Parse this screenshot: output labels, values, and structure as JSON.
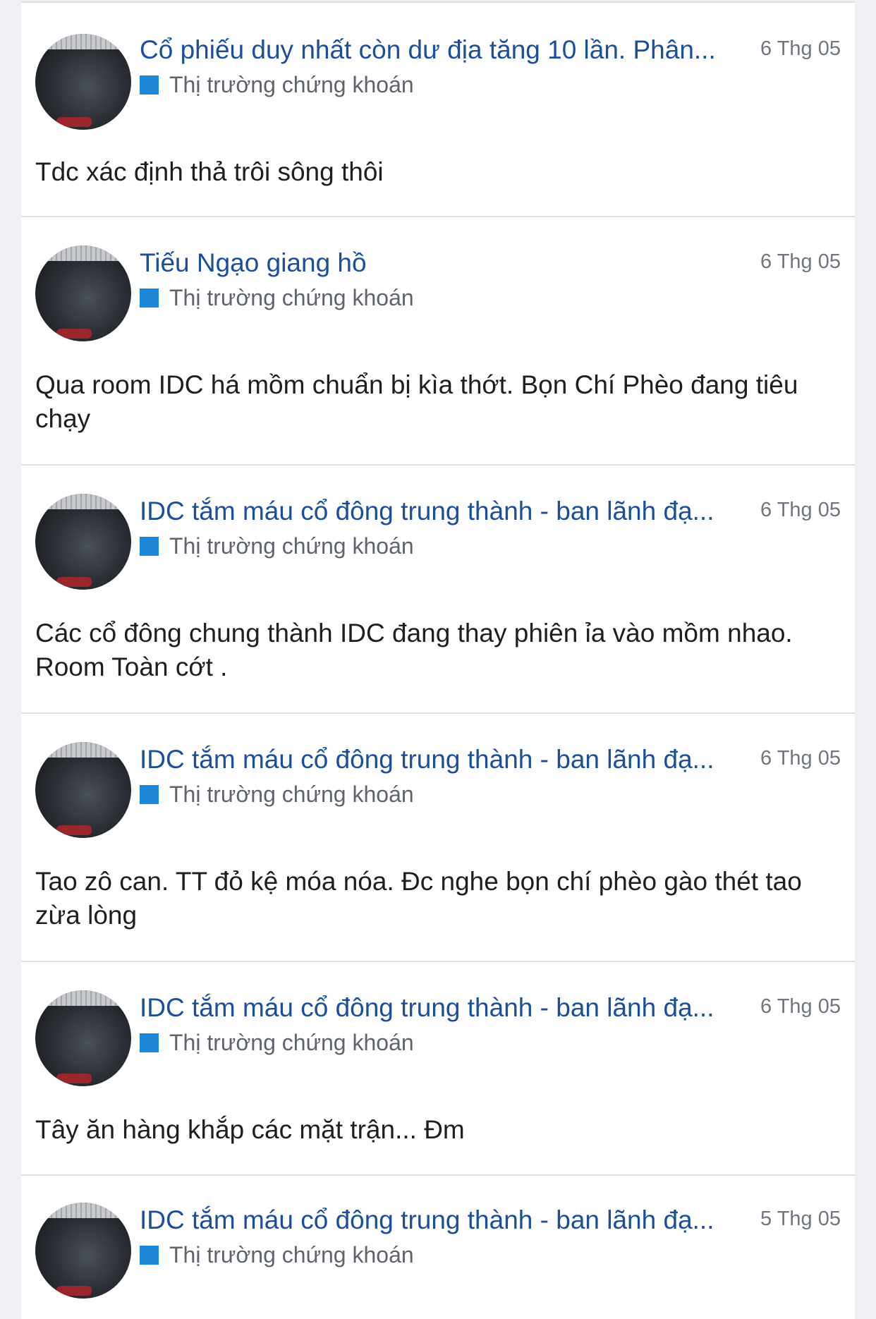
{
  "posts": [
    {
      "title": "Cổ phiếu duy nhất còn dư địa tăng 10 lần. Phân...",
      "date": "6 Thg 05",
      "category": "Thị trường chứng khoán",
      "body": "Tdc xác định thả trôi sông thôi"
    },
    {
      "title": "Tiếu Ngạo giang hồ",
      "date": "6 Thg 05",
      "category": "Thị trường chứng khoán",
      "body": "Qua room IDC há mồm chuẩn bị kìa thớt. Bọn Chí Phèo đang tiêu chạy"
    },
    {
      "title": "IDC tắm máu cổ đông trung thành - ban lãnh đạ...",
      "date": "6 Thg 05",
      "category": "Thị trường chứng khoán",
      "body": "Các cổ đông chung thành IDC đang thay phiên ỉa vào mồm nhao. Room Toàn cớt ."
    },
    {
      "title": "IDC tắm máu cổ đông trung thành - ban lãnh đạ...",
      "date": "6 Thg 05",
      "category": "Thị trường chứng khoán",
      "body": "Tao zô can. TT đỏ kệ móa nóa. Đc nghe bọn chí phèo gào thét tao zừa lòng"
    },
    {
      "title": "IDC tắm máu cổ đông trung thành - ban lãnh đạ...",
      "date": "6 Thg 05",
      "category": "Thị trường chứng khoán",
      "body": "Tây ăn hàng khắp các mặt trận... Đm"
    },
    {
      "title": "IDC tắm máu cổ đông trung thành - ban lãnh đạ...",
      "date": "5 Thg 05",
      "category": "Thị trường chứng khoán",
      "body": ""
    }
  ]
}
